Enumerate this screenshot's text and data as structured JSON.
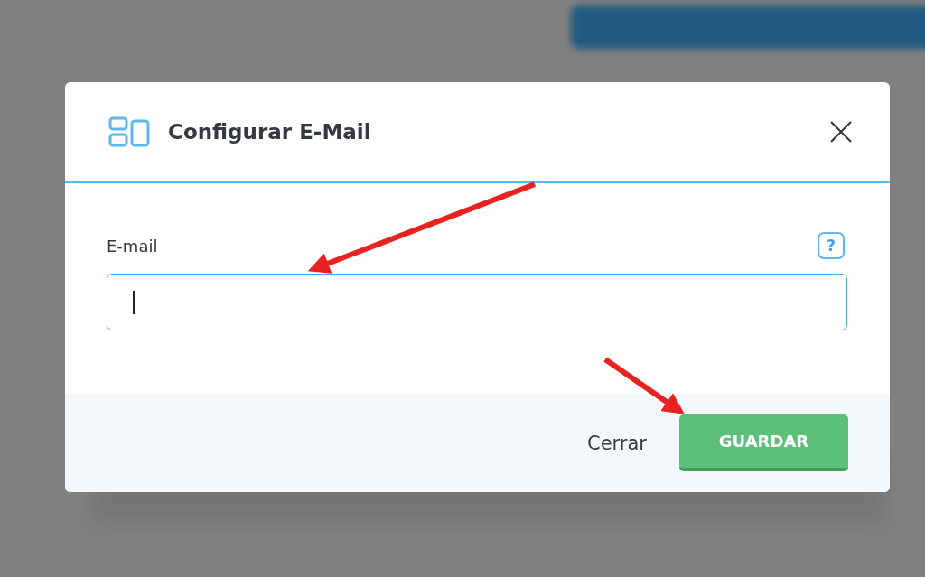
{
  "dialog": {
    "title": "Configurar E-Mail",
    "field": {
      "label": "E-mail",
      "help": "?",
      "focused": true
    },
    "buttons": [
      {
        "label": "Cerrar",
        "kind": "text"
      },
      {
        "label": "GUARDAR",
        "kind": "primary"
      }
    ]
  }
}
